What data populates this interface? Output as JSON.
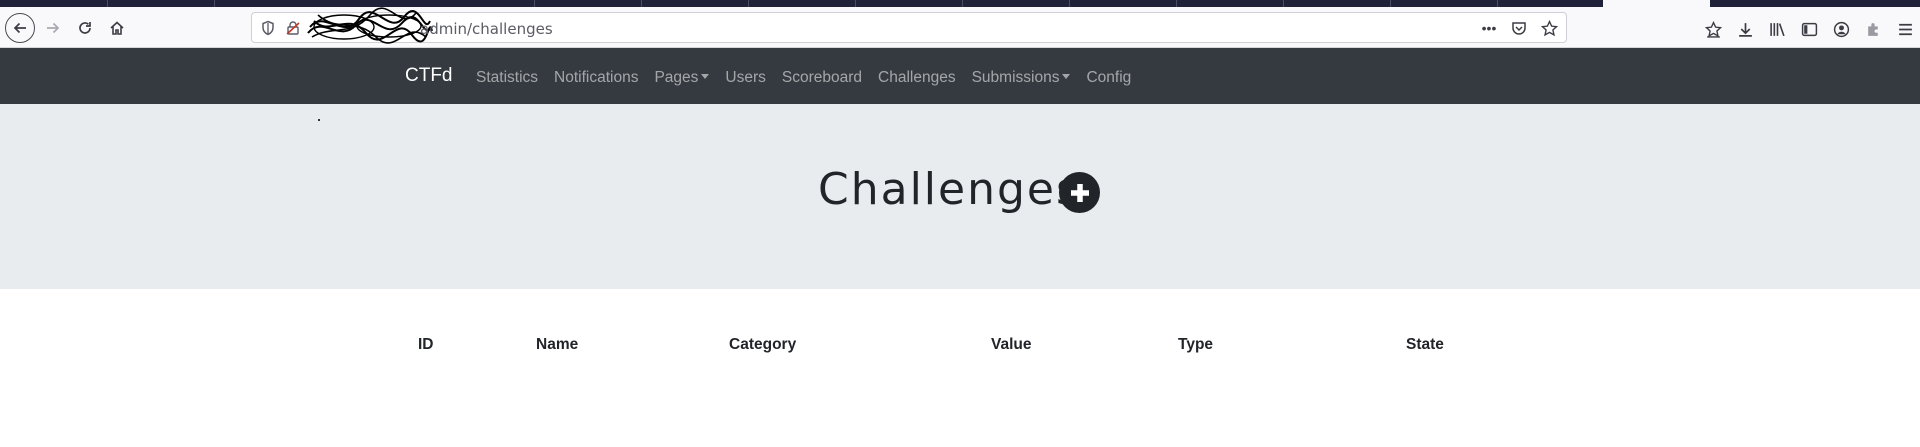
{
  "browser": {
    "url_text": "admin/challenges",
    "colors": {
      "tabstrip": "#20223a",
      "toolbar": "#f9f9fb"
    }
  },
  "navbar": {
    "brand": "CTFd",
    "items": [
      {
        "label": "Statistics",
        "dropdown": false
      },
      {
        "label": "Notifications",
        "dropdown": false
      },
      {
        "label": "Pages",
        "dropdown": true
      },
      {
        "label": "Users",
        "dropdown": false
      },
      {
        "label": "Scoreboard",
        "dropdown": false
      },
      {
        "label": "Challenges",
        "dropdown": false
      },
      {
        "label": "Submissions",
        "dropdown": true
      },
      {
        "label": "Config",
        "dropdown": false
      }
    ],
    "colors": {
      "background": "#343a40",
      "link": "rgba(255,255,255,0.55)"
    }
  },
  "jumbotron": {
    "title": "Challenges",
    "add_icon": "plus-circle-icon",
    "background": "#e9ecef"
  },
  "table": {
    "headers": [
      "ID",
      "Name",
      "Category",
      "Value",
      "Type",
      "State"
    ],
    "rows": []
  }
}
